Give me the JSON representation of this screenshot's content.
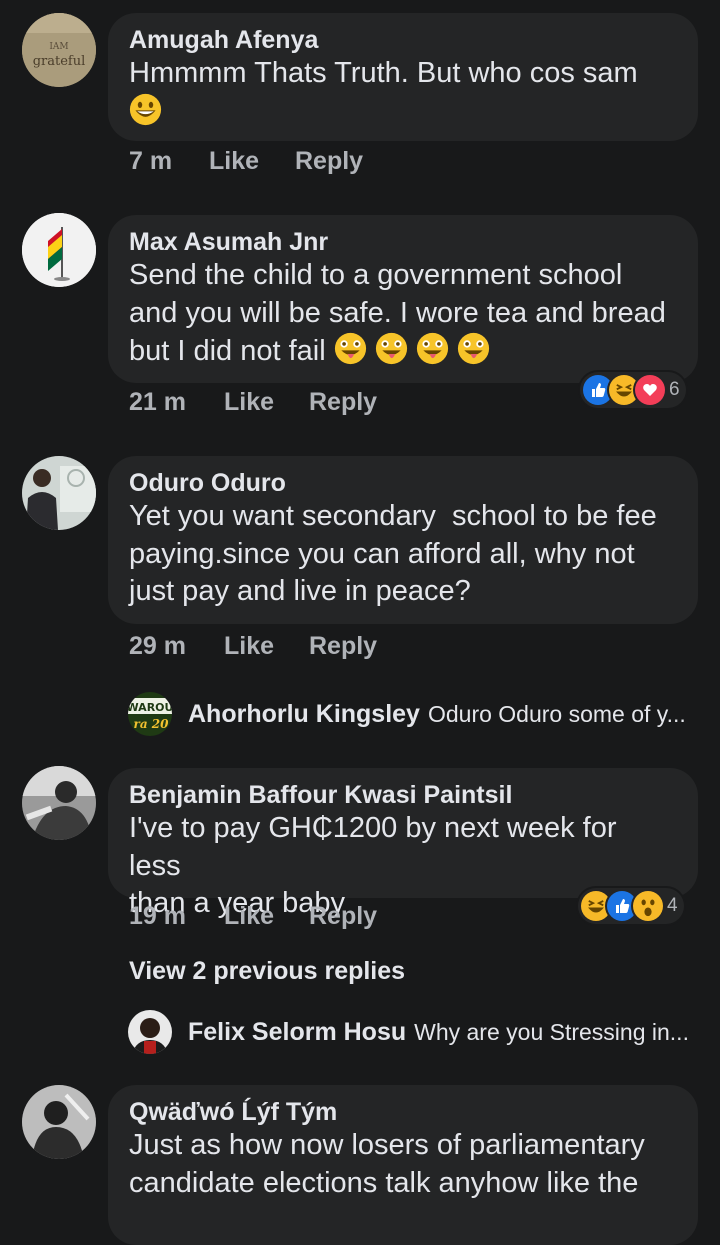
{
  "comments": [
    {
      "author": "Amugah Afenya",
      "text": "Hmmmm Thats Truth. But who cos sam",
      "avatar_text_small": "IAM",
      "avatar_text": "grateful",
      "time": "7 m",
      "like_label": "Like",
      "reply_label": "Reply"
    },
    {
      "author": "Max Asumah Jnr",
      "text_lines": [
        "Send the child to a government school",
        "and you will be safe. I wore tea and bread",
        "but I did not fail"
      ],
      "time": "21 m",
      "like_label": "Like",
      "reply_label": "Reply",
      "reaction_count": "6"
    },
    {
      "author": "Oduro Oduro",
      "text_lines": [
        "Yet you want secondary  school to be fee",
        "paying.since you can afford all, why not",
        "just pay and live in peace?"
      ],
      "time": "29 m",
      "like_label": "Like",
      "reply_label": "Reply",
      "reply": {
        "author": "Ahorhorlu Kingsley",
        "snippet": "Oduro Oduro some of y...",
        "avatar_text": "WAROU",
        "avatar_text2": "ra 20"
      }
    },
    {
      "author": "Benjamin Baffour Kwasi Paintsil",
      "text_lines": [
        "I've to pay GH₵1200 by next week for less",
        "than a year baby"
      ],
      "time": "19 m",
      "like_label": "Like",
      "reply_label": "Reply",
      "reaction_count": "4",
      "view_previous": "View 2 previous replies",
      "reply": {
        "author": "Felix Selorm Hosu",
        "snippet": "Why are you Stressing in..."
      }
    },
    {
      "author": "Qwäďwó Ĺýf Tým",
      "text_lines": [
        "Just as how now losers of parliamentary",
        "candidate elections talk anyhow like the"
      ]
    }
  ],
  "colors": {
    "background": "#18191a",
    "bubble": "#242526",
    "secondary_text": "#b0b3b8",
    "like_blue": "#1b74e4",
    "love_red": "#f33e58",
    "haha_yellow": "#f7b928"
  }
}
